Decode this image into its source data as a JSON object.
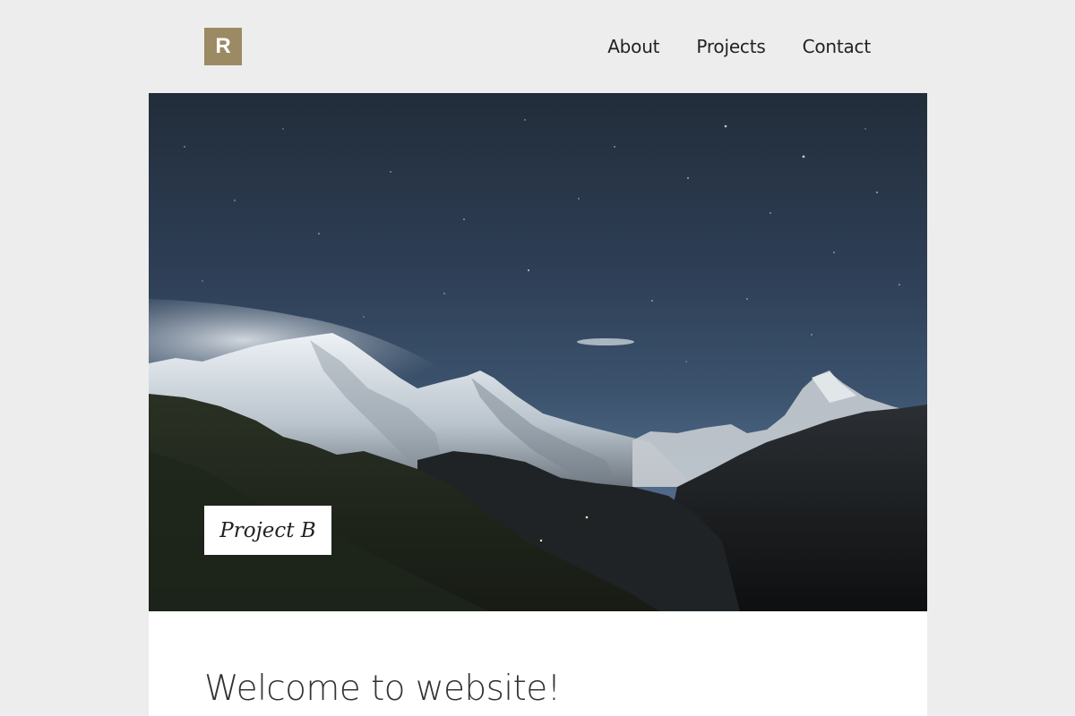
{
  "header": {
    "logo_letter": "R",
    "nav": [
      {
        "label": "About"
      },
      {
        "label": "Projects"
      },
      {
        "label": "Contact"
      }
    ]
  },
  "hero": {
    "image": "mountain-night-sky-image",
    "project_label": "Project B"
  },
  "main": {
    "heading": "Welcome to website!"
  },
  "colors": {
    "page_background": "#ededed",
    "logo_background": "#9c8a64",
    "content_background": "#ffffff",
    "text": "#222222"
  }
}
